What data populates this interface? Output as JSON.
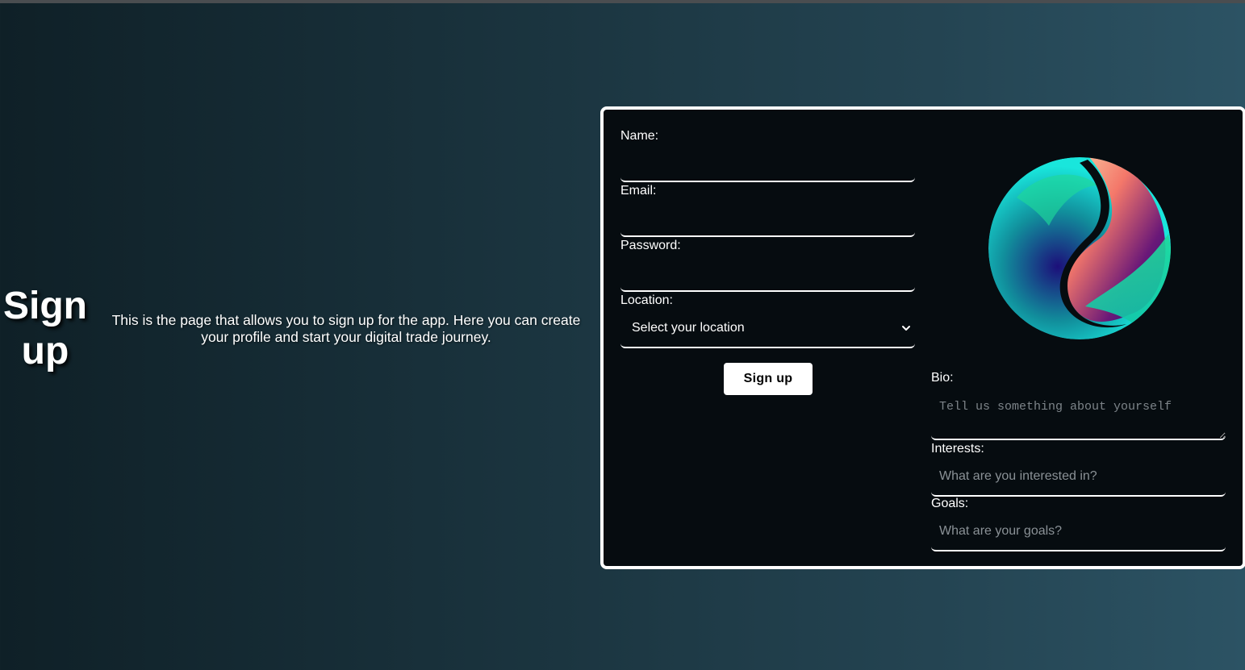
{
  "hero": {
    "title": "Sign up",
    "description": "This is the page that allows you to sign up for the app. Here you can create your profile and start your digital trade journey."
  },
  "form": {
    "name_label": "Name:",
    "email_label": "Email:",
    "password_label": "Password:",
    "location_label": "Location:",
    "location_selected": "Select your location",
    "signup_button": "Sign up",
    "bio_label": "Bio:",
    "bio_placeholder": "Tell us something about yourself",
    "interests_label": "Interests:",
    "interests_placeholder": "What are you interested in?",
    "goals_label": "Goals:",
    "goals_placeholder": "What are your goals?"
  },
  "icons": {
    "location_dropdown": "chevron-down-icon",
    "logo": "app-logo-icon"
  },
  "colors": {
    "card_background": "#060c10",
    "card_border": "#ffffff",
    "button_background": "#ffffff",
    "button_text": "#000000",
    "logo_cyan": "#19e6dc",
    "logo_navy": "#1c0f7a",
    "logo_coral": "#f4786a",
    "logo_peach": "#f9cfa6"
  }
}
